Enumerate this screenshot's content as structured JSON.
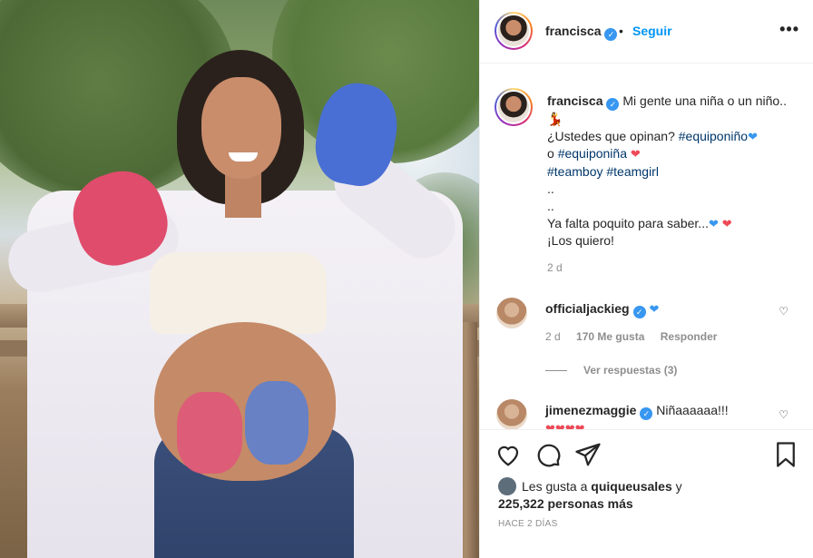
{
  "header": {
    "username": "francisca",
    "follow_label": "Seguir",
    "dot": "•",
    "more_label": "•••"
  },
  "caption": {
    "username": "francisca",
    "line1": "Mi gente una niña o un niño..",
    "line1_emoji": "💃",
    "line2_start": "¿Ustedes que opinan?",
    "tag_equiponino": "#equiponiño",
    "connector": "o",
    "tag_equiponina": "#equiponiña",
    "tag_teamboy": "#teamboy",
    "tag_teamgirl": "#teamgirl",
    "dots1": "..",
    "dots2": "..",
    "line_ya": "Ya falta poquito para saber...",
    "line_los": "¡Los quiero!",
    "time": "2 d"
  },
  "comments": [
    {
      "username": "officialjackieg",
      "text": "",
      "time": "2 d",
      "likes": "170 Me gusta",
      "reply": "Responder",
      "view_replies": "Ver respuestas (3)"
    },
    {
      "username": "jimenezmaggie",
      "text": "Niñaaaaaa!!!"
    }
  ],
  "likes": {
    "prefix": "Les gusta a",
    "user": "quiqueusales",
    "suffix": "y",
    "count": "225,322 personas más"
  },
  "date": "HACE 2 DÍAS",
  "icons": [
    "heart-icon",
    "comment-icon",
    "share-icon",
    "bookmark-icon",
    "more-icon",
    "verified-icon"
  ],
  "colors": {
    "link": "#0095f6",
    "hashtag": "#00376b",
    "verified": "#3897f0",
    "muted": "#8e8e8e"
  }
}
